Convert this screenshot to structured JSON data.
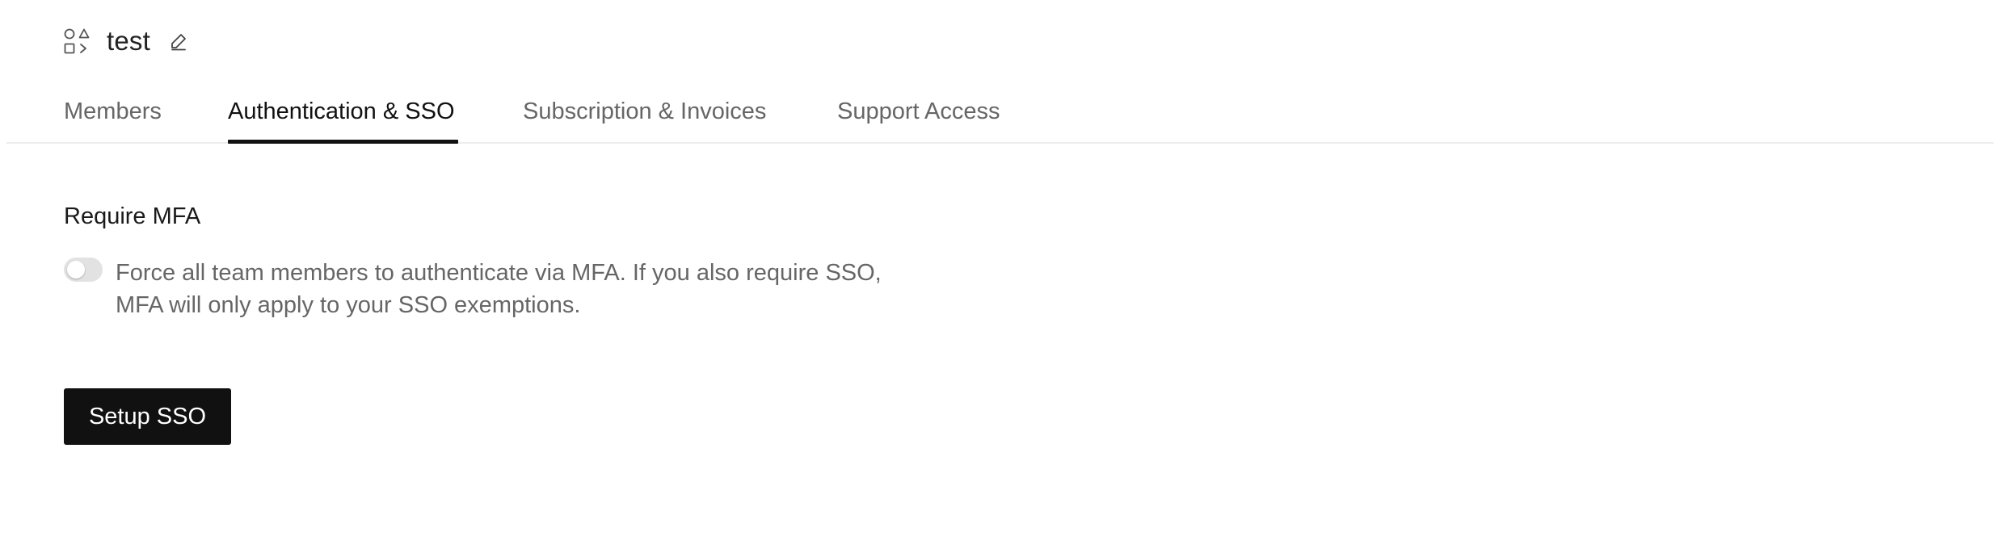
{
  "workspace": {
    "title": "test",
    "icon": "shapes-icon",
    "edit_icon": "pencil-icon"
  },
  "tabs": [
    {
      "label": "Members",
      "active": false
    },
    {
      "label": "Authentication & SSO",
      "active": true
    },
    {
      "label": "Subscription & Invoices",
      "active": false
    },
    {
      "label": "Support Access",
      "active": false
    }
  ],
  "mfa": {
    "title": "Require MFA",
    "enabled": false,
    "description_line1": "Force all team members to authenticate via MFA. If you also require SSO,",
    "description_line2": "MFA will only apply to your SSO exemptions."
  },
  "sso": {
    "button_label": "Setup SSO"
  },
  "colors": {
    "primary_button": "#111111",
    "active_tab": "#111111",
    "inactive_tab": "#666666",
    "toggle_off": "#e2e2e2"
  }
}
